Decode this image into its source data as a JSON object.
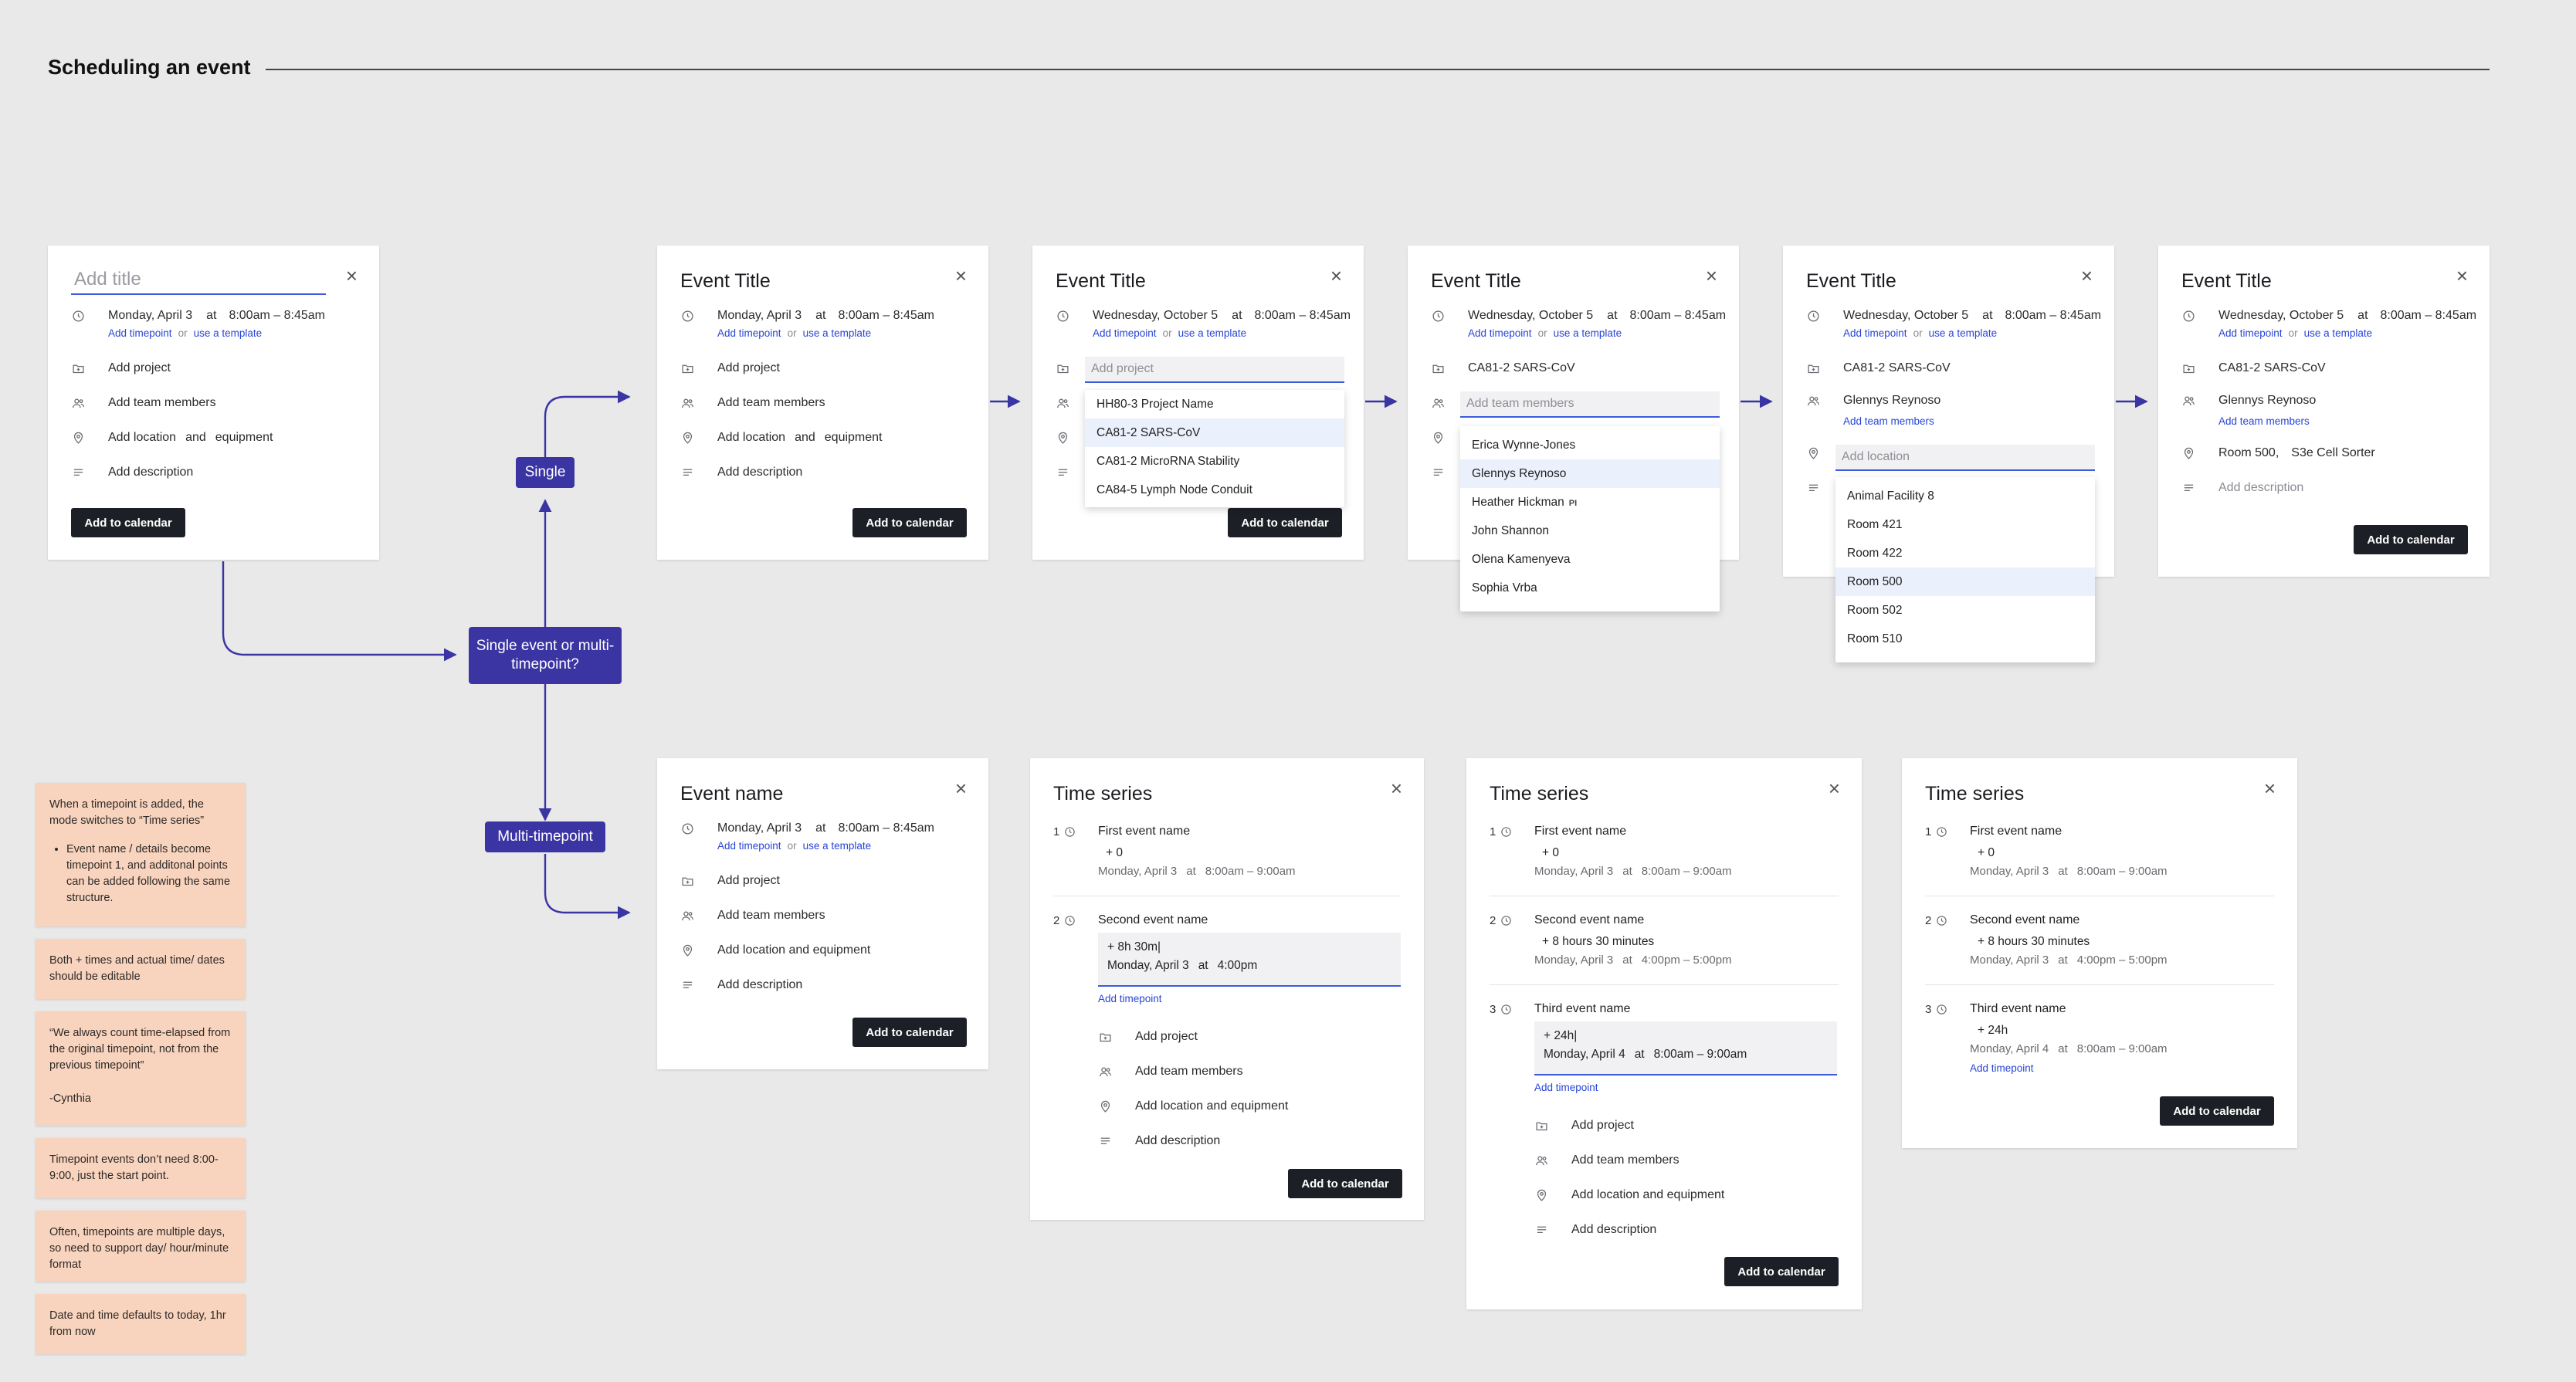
{
  "page": {
    "title": "Scheduling an event"
  },
  "common": {
    "or": "or",
    "at": "at",
    "and": "and",
    "add_timepoint": "Add timepoint",
    "use_template": "use a template",
    "add_project": "Add project",
    "add_team": "Add team members",
    "add_location": "Add location",
    "equipment": "equipment",
    "add_loc_equip": "Add location and equipment",
    "add_description": "Add description",
    "add_to_calendar": "Add to calendar",
    "close": "×",
    "monday": "Monday,  April 3",
    "wednesday": "Wednesday, October 5",
    "time_845": "8:00am – 8:45am",
    "time_900": "8:00am – 9:00am",
    "event_title": "Event Title",
    "time_series": "Time series"
  },
  "flow": {
    "decision": "Single event or multi-timepoint?",
    "single": "Single",
    "multi": "Multi-timepoint"
  },
  "card1": {
    "title_placeholder": "Add title"
  },
  "card3": {
    "placeholder": "Add project",
    "options": [
      "HH80-3 Project Name",
      "CA81-2 SARS-CoV",
      "CA81-2 MicroRNA Stability",
      "CA84-5 Lymph Node Conduit"
    ]
  },
  "card4": {
    "project": "CA81-2 SARS-CoV",
    "placeholder": "Add team members",
    "members": [
      "Erica Wynne-Jones",
      "Glennys Reynoso",
      "Heather Hickman",
      "John Shannon",
      "Olena Kamenyeva",
      "Sophia Vrba"
    ],
    "pi": "PI"
  },
  "card5": {
    "project": "CA81-2 SARS-CoV",
    "member": "Glennys Reynoso",
    "placeholder": "Add location",
    "locations": [
      "Animal Facility 8",
      "Room 421",
      "Room 422",
      "Room 500",
      "Room 502",
      "Room 510"
    ]
  },
  "card6": {
    "project": "CA81-2 SARS-CoV",
    "member": "Glennys Reynoso",
    "room": "Room 500,",
    "equipment": "S3e Cell Sorter"
  },
  "card7": {
    "title": "Event name"
  },
  "ts": {
    "first": "First event name",
    "second": "Second event name",
    "third": "Third event name",
    "plus0": "+ 0",
    "plus_8h30m": "+ 8h 30m|",
    "plus_830": "+ 8 hours 30 minutes",
    "plus_24h_cursor": "+ 24h|",
    "plus_24h": "+ 24h",
    "april3": "Monday,  April 3",
    "april4": "Monday,  April 4",
    "at_400": "4:00pm",
    "time_4_5": "4:00pm – 5:00pm",
    "n1": "1",
    "n2": "2",
    "n3": "3"
  },
  "notes": [
    "When a timepoint is added, the mode switches to “Time series”",
    "Event name / details become timepoint 1, and additonal points can be added following the same structure.",
    "Both + times and actual time/ dates should be editable",
    "“We always count time-elapsed from the original timepoint, not from the previous timepoint”",
    "-Cynthia",
    "Timepoint events don’t need 8:00-9:00, just the start point.",
    "Often, timepoints are multiple days, so need to support day/ hour/minute format",
    "Date and time defaults to today, 1hr from now"
  ],
  "colors": {
    "accent": "#3b34a3",
    "link": "#2845d6",
    "button": "#1d1f26",
    "sticky": "#f8d3bd",
    "background": "#e9e9e9"
  }
}
